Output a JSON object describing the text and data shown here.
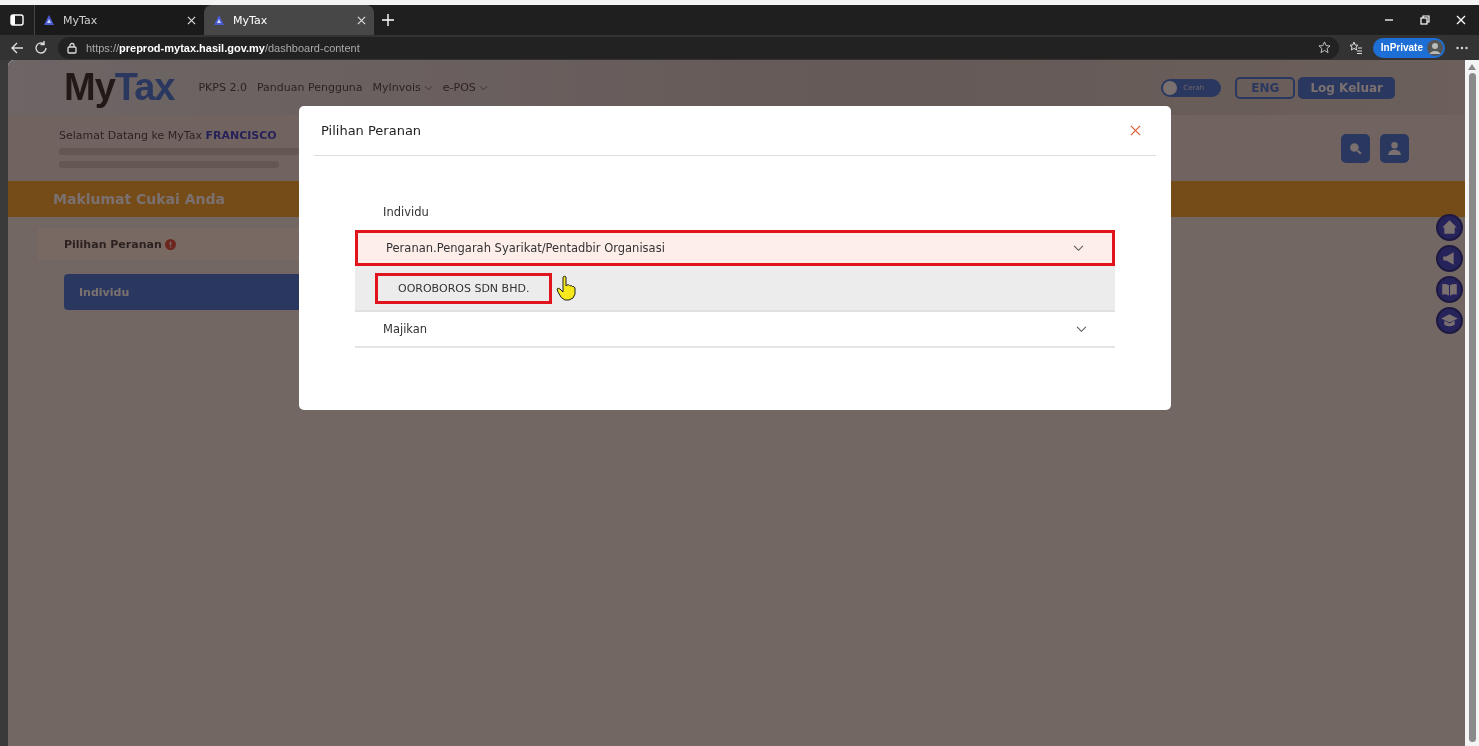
{
  "browser": {
    "tabs": [
      {
        "title": "MyTax",
        "selected": false
      },
      {
        "title": "MyTax",
        "selected": true
      }
    ],
    "address": {
      "protocol": "https://",
      "host": "preprod-mytax.hasil.gov.my",
      "path": "/dashboard-content"
    },
    "profile_badge": "InPrivate"
  },
  "header": {
    "logo": {
      "prefix": "My",
      "suffix": "Tax"
    },
    "nav": [
      {
        "label": "PKPS 2.0",
        "dropdown": false
      },
      {
        "label": "Panduan Pengguna",
        "dropdown": false
      },
      {
        "label": "MyInvois",
        "dropdown": true
      },
      {
        "label": "e-POS",
        "dropdown": true
      }
    ],
    "theme_toggle": {
      "label": "Cerah",
      "on": false
    },
    "language_button": "ENG",
    "logout_button": "Log Keluar"
  },
  "welcome": {
    "text": "Selamat Datang ke MyTax",
    "name": "FRANCISCO"
  },
  "banner_title": "Maklumat Cukai Anda",
  "side_panel": {
    "title": "Pilihan Peranan",
    "role_button": "Individu"
  },
  "modal": {
    "title": "Pilihan Peranan",
    "options": [
      {
        "label": "Individu",
        "kind": "plain",
        "highlighted": false
      },
      {
        "label": "Peranan.Pengarah Syarikat/Pentadbir Organisasi",
        "kind": "accordion",
        "expanded": true,
        "highlighted": true,
        "children": [
          {
            "label": "OOROBOROS SDN BHD.",
            "highlighted": true
          }
        ]
      },
      {
        "label": "Majikan",
        "kind": "accordion",
        "expanded": false,
        "highlighted": false
      }
    ]
  }
}
